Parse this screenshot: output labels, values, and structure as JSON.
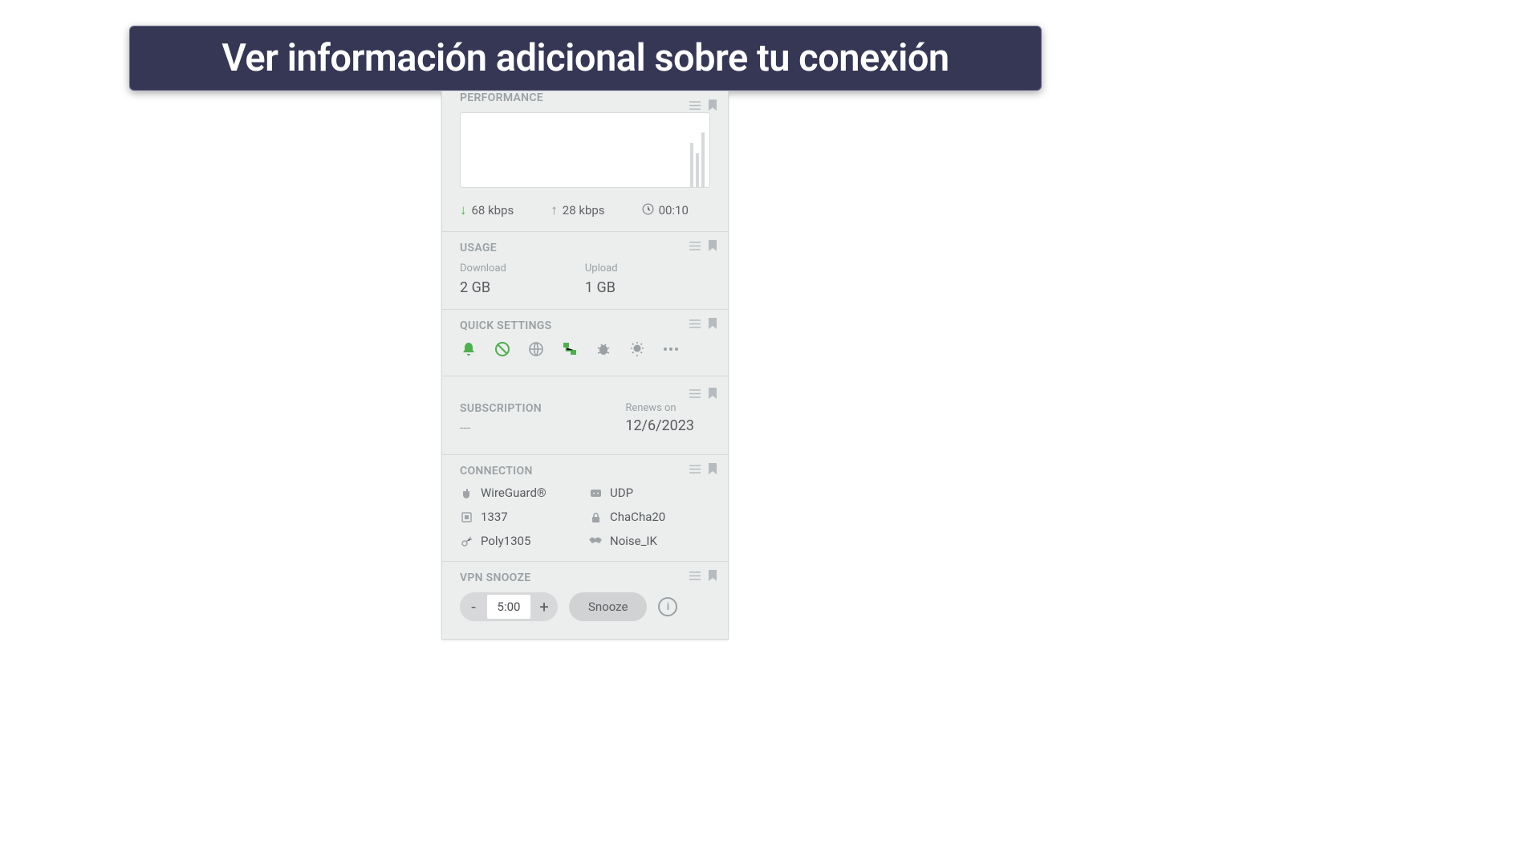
{
  "banner": {
    "text": "Ver información adicional sobre tu conexión"
  },
  "performance": {
    "header": "PERFORMANCE",
    "download_speed": "68 kbps",
    "upload_speed": "28 kbps",
    "duration": "00:10"
  },
  "usage": {
    "header": "USAGE",
    "download_label": "Download",
    "download_value": "2 GB",
    "upload_label": "Upload",
    "upload_value": "1 GB"
  },
  "quick_settings": {
    "header": "QUICK SETTINGS",
    "icons": [
      "bell",
      "shield",
      "globe",
      "network",
      "bug",
      "lightbulb",
      "more"
    ]
  },
  "subscription": {
    "header": "SUBSCRIPTION",
    "plan": "---",
    "renews_label": "Renews on",
    "renews_date": "12/6/2023"
  },
  "connection": {
    "header": "CONNECTION",
    "items": [
      {
        "icon": "plug",
        "value": "WireGuard®"
      },
      {
        "icon": "protocol",
        "value": "UDP"
      },
      {
        "icon": "port",
        "value": "1337"
      },
      {
        "icon": "lock",
        "value": "ChaCha20"
      },
      {
        "icon": "key",
        "value": "Poly1305"
      },
      {
        "icon": "handshake",
        "value": "Noise_IK"
      }
    ]
  },
  "vpn_snooze": {
    "header": "VPN SNOOZE",
    "decrement": "-",
    "value": "5:00",
    "increment": "+",
    "button": "Snooze",
    "info": "i"
  }
}
